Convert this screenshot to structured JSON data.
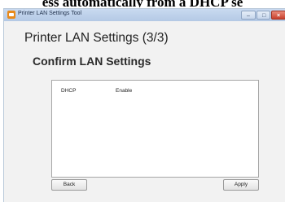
{
  "caption": "ess automatically from a DHCP se",
  "window": {
    "title": "Printer LAN Settings Tool"
  },
  "page": {
    "heading": "Printer LAN Settings (3/3)",
    "subheading": "Confirm LAN Settings"
  },
  "settings": [
    {
      "key": "DHCP",
      "value": "Enable"
    }
  ],
  "buttons": {
    "back": "Back",
    "apply": "Apply"
  },
  "colors": {
    "titlebar": "#b4c9e5",
    "window_bg": "#f2f2f2",
    "close_button": "#c8402c",
    "app_icon": "#e88a1a"
  },
  "icons": {
    "app": "printer-app-icon",
    "minimize": "minimize-icon",
    "maximize": "maximize-icon",
    "close": "close-icon"
  }
}
